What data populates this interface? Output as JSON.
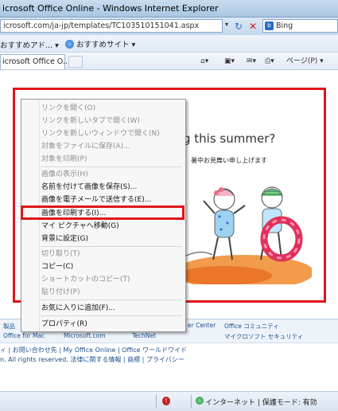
{
  "window": {
    "title": "icrosoft Office Online - Windows Internet Explorer"
  },
  "address": {
    "url": "icrosoft.com/ja-jp/templates/TC103510151041.aspx",
    "search_text": "Bing"
  },
  "favorites": {
    "item1": "おすすめアド...",
    "item2": "おすすめサイト"
  },
  "tabs": {
    "active_label": "icrosoft Office O..."
  },
  "command_bar": {
    "page_label": "ページ(P)"
  },
  "page": {
    "headline": "g this summer?",
    "subhead": "暑中お見舞い申し上げます"
  },
  "footer": {
    "row1": [
      "製品",
      "Office for Mac",
      "Microsoft.com",
      "TechNet",
      "er Center",
      "Office コミュニティ",
      "マイクロソフト セキュリティ"
    ],
    "line1": "ィ | お問い合わせ先 | My Office Online | Office ワールドワイド",
    "line2": "n. All rights reserved. 法律に関する情報 | 商標 | プライバシー"
  },
  "status": {
    "zone": "インターネット | 保護モード: 有効"
  },
  "context_menu": {
    "items": [
      {
        "label": "リンクを開く(O)"
      },
      {
        "label": "リンクを新しいタブで開く(W)"
      },
      {
        "label": "リンクを新しいウィンドウで開く(N)"
      },
      {
        "label": "対象をファイルに保存(A)..."
      },
      {
        "label": "対象を印刷(P)"
      },
      {
        "label": "画像の表示(H)"
      },
      {
        "label": "名前を付けて画像を保存(S)..."
      },
      {
        "label": "画像を電子メールで送信する(E)..."
      },
      {
        "label": "画像を印刷する(I)..."
      },
      {
        "label": "マイ ピクチャへ移動(G)"
      },
      {
        "label": "背景に設定(G)"
      },
      {
        "label": "切り取り(T)"
      },
      {
        "label": "コピー(C)"
      },
      {
        "label": "ショートカットのコピー(T)"
      },
      {
        "label": "貼り付け(P)"
      },
      {
        "label": "お気に入りに追加(F)..."
      },
      {
        "label": "プロパティ(R)"
      }
    ]
  },
  "colors": {
    "highlight_frame": "#e0151a",
    "menu_disabled": "#8d8d8d"
  }
}
